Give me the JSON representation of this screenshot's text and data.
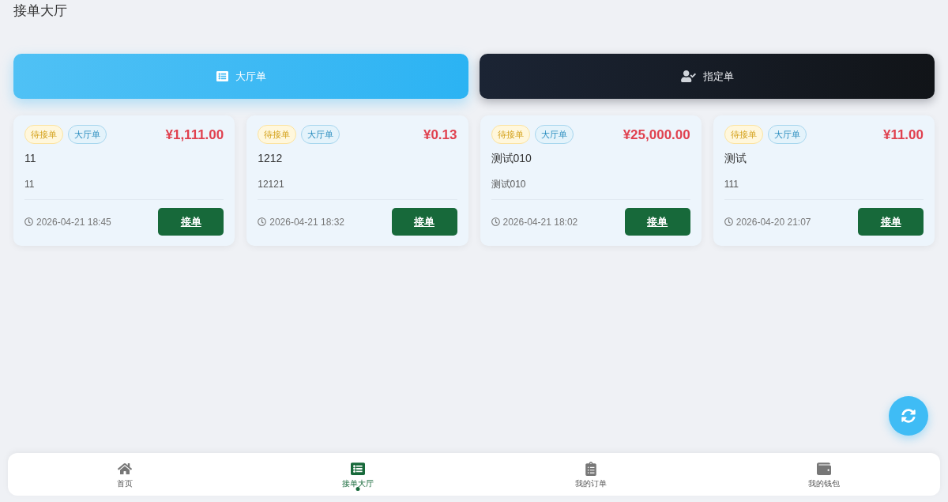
{
  "page_title": "接单大厅",
  "tabs": [
    {
      "label": "大厅单",
      "selected": true
    },
    {
      "label": "指定单",
      "selected": false
    }
  ],
  "orders": [
    {
      "tags": [
        {
          "kind": "status",
          "label": "待接单"
        },
        {
          "kind": "type",
          "label": "大厅单"
        }
      ],
      "price": "¥1,111.00",
      "title": "11",
      "description": "11",
      "time": "2026-04-21 18:45",
      "action": "接单"
    },
    {
      "tags": [
        {
          "kind": "status",
          "label": "待接单"
        },
        {
          "kind": "type",
          "label": "大厅单"
        }
      ],
      "price": "¥0.13",
      "title": "1212",
      "description": "12121",
      "time": "2026-04-21 18:32",
      "action": "接单"
    },
    {
      "tags": [
        {
          "kind": "status",
          "label": "待接单"
        },
        {
          "kind": "type",
          "label": "大厅单"
        }
      ],
      "price": "¥25,000.00",
      "title": "测试010",
      "description": "测试010",
      "time": "2026-04-21 18:02",
      "action": "接单"
    },
    {
      "tags": [
        {
          "kind": "status",
          "label": "待接单"
        },
        {
          "kind": "type",
          "label": "大厅单"
        }
      ],
      "price": "¥11.00",
      "title": "测试",
      "description": "111",
      "time": "2026-04-20 21:07",
      "action": "接单"
    }
  ],
  "bottom_nav": [
    {
      "label": "首页",
      "selected": false
    },
    {
      "label": "接单大厅",
      "selected": true
    },
    {
      "label": "我的订单",
      "selected": false
    },
    {
      "label": "我的钱包",
      "selected": false
    }
  ]
}
